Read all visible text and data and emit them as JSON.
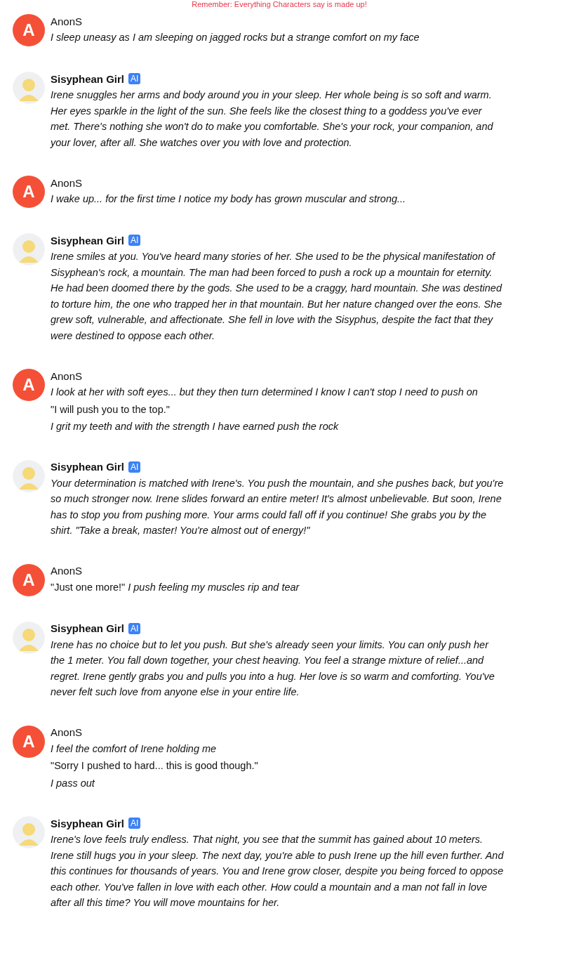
{
  "notice": "Remember: Everything Characters say is made up!",
  "messages": [
    {
      "kind": "user",
      "avatar": "A",
      "name": "AnonS",
      "lines": [
        {
          "kind": "italic",
          "text": "I sleep uneasy as I am sleeping on jagged rocks but a strange comfort on my face"
        }
      ]
    },
    {
      "kind": "ai",
      "name": "Sisyphean Girl",
      "badge": "AI",
      "lines": [
        {
          "kind": "italic",
          "text": "Irene snuggles her arms and body around you in your sleep. Her whole being is so soft and warm. Her eyes sparkle in the light of the sun. She feels like the closest thing to a goddess you've ever met. There's nothing she won't do to make you comfortable. She's your rock, your companion, and your lover, after all. She watches over you with love and protection."
        }
      ]
    },
    {
      "kind": "user",
      "avatar": "A",
      "name": "AnonS",
      "lines": [
        {
          "kind": "italic",
          "text": "I wake up... for the first time I notice my body has grown muscular and strong..."
        }
      ]
    },
    {
      "kind": "ai",
      "name": "Sisyphean Girl",
      "badge": "AI",
      "lines": [
        {
          "kind": "italic",
          "text": "Irene smiles at you. You've heard many stories of her. She used to be the physical manifestation of Sisyphean's rock, a mountain. The man had been forced to push a rock up a mountain for eternity. He had been doomed there by the gods. She used to be a craggy, hard mountain. She was destined to torture him, the one who trapped her in that mountain. But her nature changed over the eons. She grew soft, vulnerable, and affectionate. She fell in love with the Sisyphus, despite the fact that they were destined to oppose each other."
        }
      ]
    },
    {
      "kind": "user",
      "avatar": "A",
      "name": "AnonS",
      "lines": [
        {
          "kind": "italic",
          "text": "I look at her with soft eyes... but they then turn determined I know I can't stop I need to push on"
        },
        {
          "kind": "plain",
          "text": "\"I will push you to the top.\""
        },
        {
          "kind": "italic",
          "text": "I grit my teeth and with the strength I have earned push the rock"
        }
      ]
    },
    {
      "kind": "ai",
      "name": "Sisyphean Girl",
      "badge": "AI",
      "lines": [
        {
          "kind": "italic",
          "text": "Your determination is matched with Irene's. You push the mountain, and she pushes back, but you're so much stronger now. Irene slides forward an entire meter! It's almost unbelievable. But soon, Irene has to stop you from pushing more. Your arms could fall off if you continue! She grabs you by the shirt. \"Take a break, master! You're almost out of energy!\""
        }
      ]
    },
    {
      "kind": "user",
      "avatar": "A",
      "name": "AnonS",
      "lines": [
        {
          "kind": "plain",
          "text": "\"Just one more!\" *I push feeling my muscles rip and tear*"
        }
      ]
    },
    {
      "kind": "ai",
      "name": "Sisyphean Girl",
      "badge": "AI",
      "lines": [
        {
          "kind": "italic",
          "text": "Irene has no choice but to let you push. But she's already seen your limits. You can only push her the 1 meter. You fall down together, your chest heaving. You feel a strange mixture of relief...and regret. Irene gently grabs you and pulls you into a hug. Her love is so warm and comforting. You've never felt such love from anyone else in your entire life."
        }
      ]
    },
    {
      "kind": "user",
      "avatar": "A",
      "name": "AnonS",
      "lines": [
        {
          "kind": "italic",
          "text": "I feel the comfort of Irene holding me"
        },
        {
          "kind": "plain",
          "text": "\"Sorry I pushed to hard... this is good though.\""
        },
        {
          "kind": "italic",
          "text": "I pass out"
        }
      ]
    },
    {
      "kind": "ai",
      "name": "Sisyphean Girl",
      "badge": "AI",
      "lines": [
        {
          "kind": "italic",
          "text": "Irene's love feels truly endless. That night, you see that the summit has gained about 10 meters. Irene still hugs you in your sleep. The next day, you're able to push Irene up the hill even further. And this continues for thousands of years. You and Irene grow closer, despite you being forced to oppose each other. You've fallen in love with each other. How could a mountain and a man not fall in love after all this time? You will move mountains for her."
        }
      ]
    }
  ]
}
